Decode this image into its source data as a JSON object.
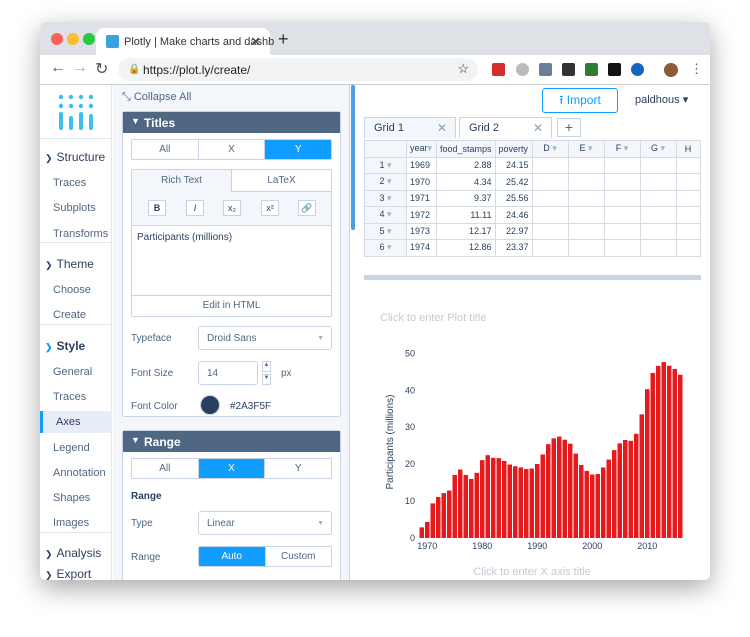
{
  "browser": {
    "tab_title": "Plotly | Make charts and dashb",
    "url": "https://plot.ly/create/"
  },
  "nav": {
    "structure": "Structure",
    "traces": "Traces",
    "subplots": "Subplots",
    "transforms": "Transforms",
    "theme": "Theme",
    "choose": "Choose",
    "create": "Create",
    "style": "Style",
    "general": "General",
    "traces2": "Traces",
    "axes": "Axes",
    "legend": "Legend",
    "annotation": "Annotation",
    "shapes": "Shapes",
    "images": "Images",
    "analysis": "Analysis",
    "export": "Export"
  },
  "panel": {
    "collapse_all": "Collapse All",
    "titles": {
      "header": "Titles",
      "axis_options": [
        "All",
        "X",
        "Y"
      ],
      "editor_tabs": [
        "Rich Text",
        "LaTeX"
      ],
      "text": "Participants (millions)",
      "edit_html": "Edit in HTML",
      "typeface_label": "Typeface",
      "typeface": "Droid Sans",
      "font_size_label": "Font Size",
      "font_size": "14",
      "px": "px",
      "font_color_label": "Font Color",
      "font_color": "#2A3F5F"
    },
    "range": {
      "header": "Range",
      "axis_options": [
        "All",
        "X",
        "Y"
      ],
      "subheader": "Range",
      "type_label": "Type",
      "type": "Linear",
      "range_label": "Range",
      "range_options": [
        "Auto",
        "Custom"
      ]
    }
  },
  "header": {
    "import": "Import",
    "user": "paldhous"
  },
  "grid": {
    "tabs": [
      "Grid 1",
      "Grid 2"
    ],
    "columns": [
      "year",
      "food_stamps",
      "poverty",
      "D",
      "E",
      "F",
      "G",
      "H"
    ],
    "rows": [
      [
        "1",
        "1969",
        "2.88",
        "24.15"
      ],
      [
        "2",
        "1970",
        "4.34",
        "25.42"
      ],
      [
        "3",
        "1971",
        "9.37",
        "25.56"
      ],
      [
        "4",
        "1972",
        "11.11",
        "24.46"
      ],
      [
        "5",
        "1973",
        "12.17",
        "22.97"
      ],
      [
        "6",
        "1974",
        "12.86",
        "23.37"
      ]
    ]
  },
  "plot": {
    "title_placeholder": "Click to enter Plot title",
    "x_title_placeholder": "Click to enter X axis title"
  },
  "chart_data": {
    "type": "bar",
    "x": [
      1969,
      1970,
      1971,
      1972,
      1973,
      1974,
      1975,
      1976,
      1977,
      1978,
      1979,
      1980,
      1981,
      1982,
      1983,
      1984,
      1985,
      1986,
      1987,
      1988,
      1989,
      1990,
      1991,
      1992,
      1993,
      1994,
      1995,
      1996,
      1997,
      1998,
      1999,
      2000,
      2001,
      2002,
      2003,
      2004,
      2005,
      2006,
      2007,
      2008,
      2009,
      2010,
      2011,
      2012,
      2013,
      2014,
      2015,
      2016
    ],
    "values": [
      2.88,
      4.34,
      9.37,
      11.11,
      12.17,
      12.86,
      17.06,
      18.55,
      17.08,
      16.0,
      17.65,
      21.08,
      22.43,
      21.72,
      21.63,
      20.85,
      19.9,
      19.43,
      19.11,
      18.67,
      18.81,
      20.05,
      22.62,
      25.41,
      26.99,
      27.47,
      26.62,
      25.54,
      22.86,
      19.79,
      18.18,
      17.19,
      17.32,
      19.1,
      21.25,
      23.81,
      25.63,
      26.55,
      26.32,
      28.22,
      33.49,
      40.3,
      44.71,
      46.61,
      47.64,
      46.66,
      45.77,
      44.22
    ],
    "ylabel": "Participants (millions)",
    "xlabel": "",
    "yticks": [
      0,
      10,
      20,
      30,
      40,
      50
    ],
    "xticks": [
      1970,
      1980,
      1990,
      2000,
      2010
    ],
    "ylim": [
      0,
      52
    ],
    "color": "#e41a1c"
  }
}
